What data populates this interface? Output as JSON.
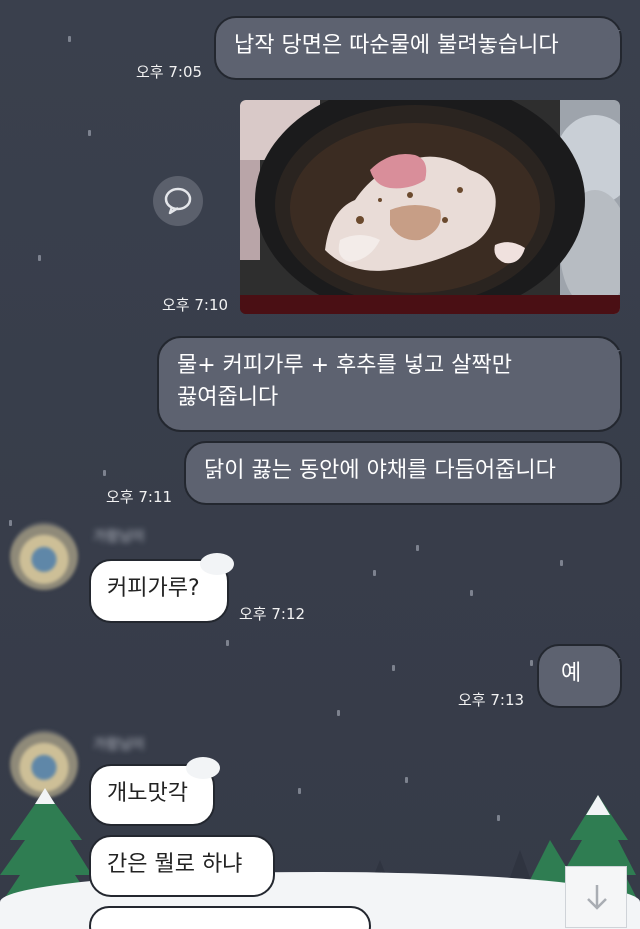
{
  "chat": {
    "messages": [
      {
        "side": "mine",
        "text": "납작 당면은 따순물에 불려놓습니다",
        "time": "오후 7:05"
      },
      {
        "side": "mine",
        "type": "photo",
        "time": "오후 7:10"
      },
      {
        "side": "mine",
        "text_line1": "물+ 커피가루 + 후추를 넣고 살짝만",
        "text_line2": "끓여줍니다"
      },
      {
        "side": "mine",
        "text": "닭이 끓는 동안에 야채를 다듬어줍니다",
        "time": "오후 7:11"
      },
      {
        "side": "theirs",
        "text": "커피가루?",
        "time": "오후 7:12"
      },
      {
        "side": "mine",
        "text": "예",
        "time": "오후 7:13"
      },
      {
        "side": "theirs",
        "text": "개노맛각"
      },
      {
        "side": "theirs",
        "text": "간은 뭘로 하냐"
      }
    ]
  },
  "colors": {
    "background": "#373d4a",
    "my_bubble": "#5d6270",
    "their_bubble": "#ffffff",
    "tree": "#2f7d52"
  },
  "icons": {
    "share": "speech-bubble-icon",
    "scroll_down": "down-arrow-icon"
  }
}
